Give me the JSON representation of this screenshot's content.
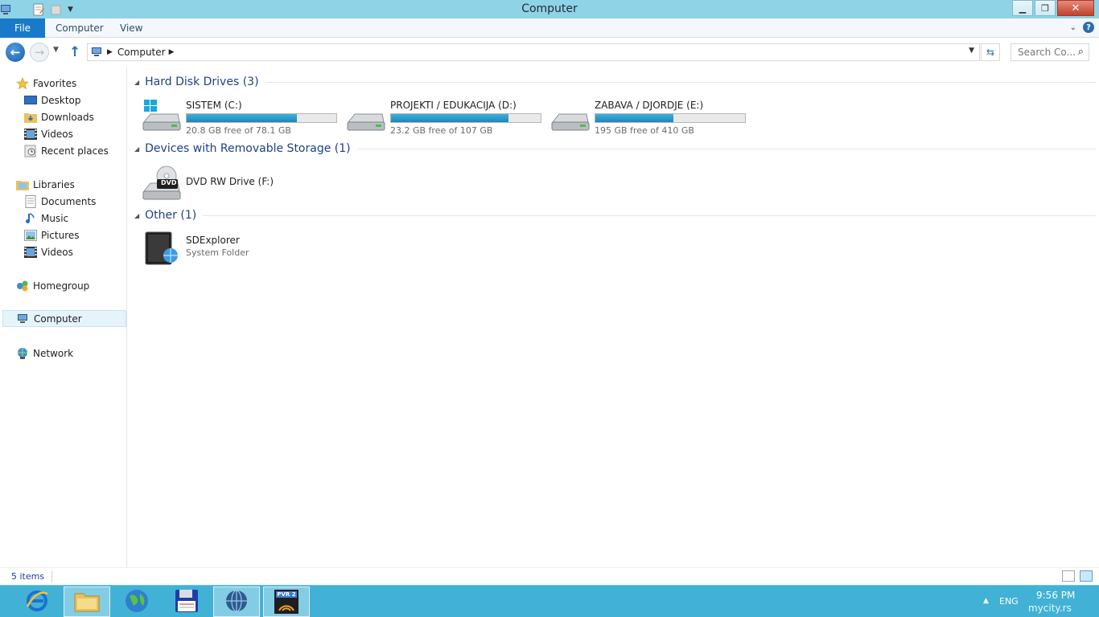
{
  "window": {
    "title": "Computer"
  },
  "ribbon": {
    "tabs": [
      "File",
      "Computer",
      "View"
    ],
    "file_color": "#1979ca"
  },
  "address_bar": {
    "crumbs": [
      "Computer"
    ],
    "search_placeholder": "Search Co..."
  },
  "nav_pane": {
    "favorites": {
      "label": "Favorites",
      "items": [
        "Desktop",
        "Downloads",
        "Videos",
        "Recent places"
      ]
    },
    "libraries": {
      "label": "Libraries",
      "items": [
        "Documents",
        "Music",
        "Pictures",
        "Videos"
      ]
    },
    "homegroup": "Homegroup",
    "computer": "Computer",
    "network": "Network"
  },
  "groups": {
    "hard_disks": {
      "title": "Hard Disk Drives (3)",
      "drives": [
        {
          "name": "SISTEM (C:)",
          "free": "20.8 GB free of 78.1 GB",
          "used_fraction": 0.734
        },
        {
          "name": "PROJEKTI / EDUKACIJA (D:)",
          "free": "23.2 GB free of 107 GB",
          "used_fraction": 0.783
        },
        {
          "name": "ZABAVA / DJORDJE (E:)",
          "free": "195 GB free of 410 GB",
          "used_fraction": 0.524
        }
      ]
    },
    "removable": {
      "title": "Devices with Removable Storage (1)",
      "items": [
        {
          "name": "DVD RW Drive (F:)",
          "badge": "DVD"
        }
      ]
    },
    "other": {
      "title": "Other (1)",
      "items": [
        {
          "name": "SDExplorer",
          "subtitle": "System Folder"
        }
      ]
    }
  },
  "status": {
    "item_count": "5 items"
  },
  "taskbar": {
    "tray_language": "ENG",
    "tray_time": "9:56 PM",
    "tray_watermark": "mycity.rs",
    "pvr_label": "PVR 2"
  },
  "colors": {
    "title_bar": "#8fd3e6",
    "taskbar": "#41b2d6",
    "group_title": "#1e3f8c",
    "drive_bar": "#2a9bd0"
  }
}
